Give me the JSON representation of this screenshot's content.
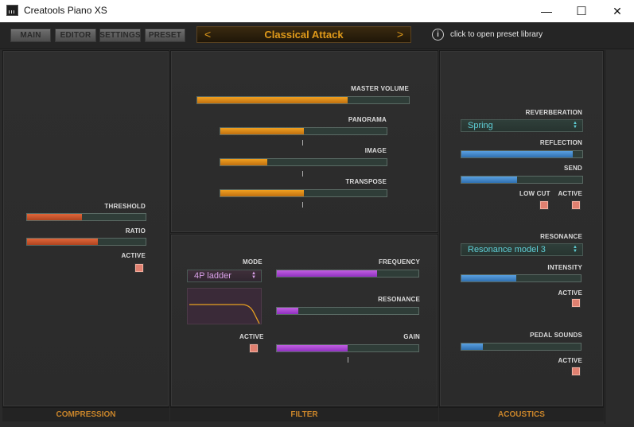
{
  "window": {
    "title": "Creatools Piano XS",
    "minimize_glyph": "—",
    "maximize_glyph": "☐",
    "close_glyph": "✕"
  },
  "toolbar": {
    "tabs": [
      "MAIN",
      "EDITOR",
      "SETTINGS",
      "PRESET"
    ],
    "preset_name": "Classical Attack",
    "prev_arrow": "<",
    "next_arrow": ">",
    "info_icon": "i",
    "info_text": "click to open preset library"
  },
  "compression": {
    "footer": "COMPRESSION",
    "threshold_label": "THRESHOLD",
    "threshold_value": 0.46,
    "ratio_label": "RATIO",
    "ratio_value": 0.6,
    "active_label": "ACTIVE",
    "active": true
  },
  "main": {
    "master_volume_label": "MASTER VOLUME",
    "master_volume": 0.71,
    "panorama_label": "PANORAMA",
    "panorama": 0.5,
    "image_label": "IMAGE",
    "image": 0.28,
    "transpose_label": "TRANSPOSE",
    "transpose": 0.5
  },
  "filter": {
    "footer": "FILTER",
    "mode_label": "MODE",
    "mode_value": "4P ladder",
    "active_label": "ACTIVE",
    "active": true,
    "frequency_label": "FREQUENCY",
    "frequency": 0.71,
    "resonance_label": "RESONANCE",
    "resonance": 0.15,
    "gain_label": "GAIN",
    "gain": 0.5
  },
  "acoustics": {
    "footer": "ACOUSTICS",
    "reverberation_label": "REVERBERATION",
    "reverberation_value": "Spring",
    "reflection_label": "REFLECTION",
    "reflection": 0.92,
    "send_label": "SEND",
    "send": 0.46,
    "low_cut_label": "LOW CUT",
    "low_cut": true,
    "reverb_active_label": "ACTIVE",
    "reverb_active": true,
    "resonance_label": "RESONANCE",
    "resonance_value": "Resonance model 3",
    "intensity_label": "INTENSITY",
    "intensity": 0.46,
    "resonance_active_label": "ACTIVE",
    "resonance_active": true,
    "pedal_sounds_label": "PEDAL SOUNDS",
    "pedal_sounds": 0.18,
    "pedal_active_label": "ACTIVE",
    "pedal_active": true
  },
  "colors": {
    "accent_orange": "#e09a1a",
    "compression_red": "#e0663a",
    "filter_purple": "#c060e0",
    "acoustics_blue": "#5aa0e0",
    "teal_text": "#5fd0d8"
  }
}
